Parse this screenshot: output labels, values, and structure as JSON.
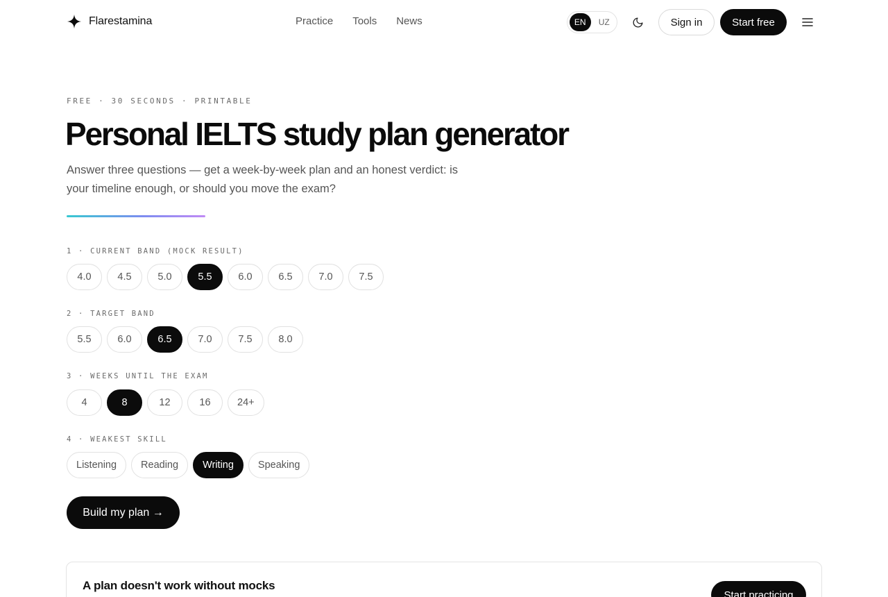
{
  "header": {
    "brand_name": "Flarestamina",
    "brand_icon": "sparkle-icon",
    "nav": [
      "Practice",
      "Tools",
      "News"
    ],
    "lang": {
      "en": "EN",
      "uz": "UZ",
      "active": "EN"
    },
    "theme_icon": "moon-icon",
    "sign_in": "Sign in",
    "start_free": "Start free",
    "menu_icon": "hamburger-menu-icon"
  },
  "hero": {
    "eyebrow": "FREE · 30 SECONDS · PRINTABLE",
    "title": "Personal IELTS study plan generator",
    "subtitle": "Answer three questions — get a week-by-week plan and an honest verdict: is your timeline enough, or should you move the exam?",
    "accent_colors": [
      "#37c8d1",
      "#7d8cf0",
      "#c08af5"
    ]
  },
  "questions": [
    {
      "label": "1 · CURRENT BAND (MOCK RESULT)",
      "options": [
        "4.0",
        "4.5",
        "5.0",
        "5.5",
        "6.0",
        "6.5",
        "7.0",
        "7.5"
      ],
      "selected": "5.5"
    },
    {
      "label": "2 · TARGET BAND",
      "options": [
        "5.5",
        "6.0",
        "6.5",
        "7.0",
        "7.5",
        "8.0"
      ],
      "selected": "6.5"
    },
    {
      "label": "3 · WEEKS UNTIL THE EXAM",
      "options": [
        "4",
        "8",
        "12",
        "16",
        "24+"
      ],
      "selected": "8"
    },
    {
      "label": "4 · WEAKEST SKILL",
      "options": [
        "Listening",
        "Reading",
        "Writing",
        "Speaking"
      ],
      "selected": "Writing"
    }
  ],
  "build_button": "Build my plan →",
  "promo_card": {
    "title": "A plan doesn't work without mocks",
    "button": "Start practicing"
  }
}
